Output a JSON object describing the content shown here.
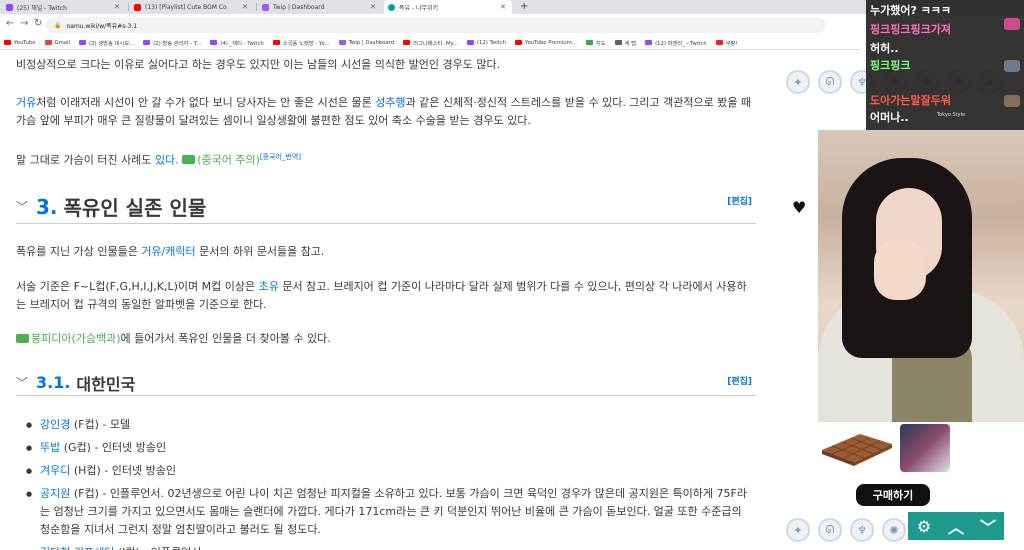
{
  "tabs": [
    {
      "title": "(25) 채널 - Twitch",
      "color": "#9146ff"
    },
    {
      "title": "(13) [Playlist] Cute BGM Co",
      "color": "#ff0000"
    },
    {
      "title": "Twip | Dashboard",
      "color": "#9b5de5"
    },
    {
      "title": "폭유 - 나무위키",
      "color": "#00a495"
    }
  ],
  "address": {
    "url": "namu.wiki/w/폭유#s-3.1"
  },
  "bookmarks": [
    {
      "label": "YouTube",
      "color": "#ff0000"
    },
    {
      "label": "Gmail",
      "color": "#ea4335"
    },
    {
      "label": "(2) 생방송 대시보...",
      "color": "#9146ff"
    },
    {
      "label": "(2) 방송 관리자 - T...",
      "color": "#9146ff"
    },
    {
      "label": "(4) _채티 - Twitch",
      "color": "#9146ff"
    },
    {
      "label": "소국동 노래방 - Yo...",
      "color": "#ff0000"
    },
    {
      "label": "Twip | Dashboard",
      "color": "#9b5de5"
    },
    {
      "label": "러그나페스타 -My...",
      "color": "#ff0000"
    },
    {
      "label": "(12) Twitch",
      "color": "#9146ff"
    },
    {
      "label": "YouTube Premium...",
      "color": "#ff0000"
    },
    {
      "label": "지도",
      "color": "#34a853"
    },
    {
      "label": "새 탭",
      "color": "#5f6368"
    },
    {
      "label": "(12) 마젠타_ - Twitch",
      "color": "#9146ff"
    },
    {
      "label": "쿠팡!",
      "color": "#e52528"
    }
  ],
  "article": {
    "p_top": "비정상적으로 크다는 이유로 싫어다고 하는 경우도 있지만 이는 남들의 시선을 의식한 발언인 경우도 많다.",
    "p2_link1": "거유",
    "p2_text1": "처럼 이래저래 시선이 안 갈 수가 없다 보니 당사자는 안 좋은 시선은 물론 ",
    "p2_link2": "성추행",
    "p2_text2": "과 같은 신체적·정신적 스트레스를 받을 수 있다. 그리고 객관적으로 봤을 때 가슴 앞에 부피가 매우 큰 질량물이 달려있는 셈이니 일상생활에 불편한 점도 있어 축소 수술을 받는 경우도 있다.",
    "p3_text": "말 그대로 가슴이 터진 사례도 ",
    "p3_link": "있다.",
    "p3_ext": "(중국어 주의)",
    "p3_sup": "[중국어_번역]",
    "h2": {
      "num": "3.",
      "title": "폭유인 실존 인물",
      "edit": "[편집]"
    },
    "p4_text1": "폭유를 지닌 가상 인물들은 ",
    "p4_link": "거유/캐릭터",
    "p4_text2": " 문서의 하위 문서들을 참고.",
    "p5_text1": "서술 기준은 F~L컵(F,G,H,I,J,K,L)이며 M컵 이상은 ",
    "p5_link": "초유",
    "p5_text2": " 문서 참고. 브레지어 컵 기준이 나라마다 달라 실제 범위가 다를 수 있으나, 편의상 각 나라에서 사용하는 브레지어 컵 규격의 동일한 알파벳을 기준으로 한다.",
    "p6_ext": "붕피디아(가슴백과)",
    "p6_text": "에 들어가서 폭유인 인물을 더 찾아볼 수 있다.",
    "h3": {
      "num": "3.1.",
      "title": "대한민국",
      "edit": "[편집]"
    },
    "list": [
      {
        "link": "강인경",
        "text": " (F컵) - 모델"
      },
      {
        "link": "뚜밥",
        "text": " (G컵) - 인터넷 방송인"
      },
      {
        "link": "겨우디",
        "text": " (H컵) - 인터넷 방송인"
      },
      {
        "link": "공지원",
        "text": " (F컵) - 인플루언서. 02년생으로 어린 나이 치곤 엄청난 피지컬을 소유하고 있다. 보통 가슴이 크면 육덕인 경우가 많은데 공지원은 특이하게 75F라는 엄청난 크기를 가지고 있으면서도 몸매는 슬랜더에 가깝다. 게다가 171cm라는 큰 키 덕분인지 뛰어난 비율에 큰 가슴이 돋보인다. 얼굴 또한 수준급의 청순함을 지녀서 그런지 정말 엄친딸이라고 불러도 될 정도다."
      },
      {
        "link": "김다현 리프세터",
        "text": " (I컵) - 인플루언서"
      }
    ]
  },
  "stream": {
    "chat": [
      {
        "text": "누가했어? ㅋㅋㅋ",
        "color": "#ffffff"
      },
      {
        "text": "핑크핑크핑크가져",
        "color": "#ff6fb5"
      },
      {
        "text": "허허..",
        "color": "#ffffff"
      },
      {
        "text": "핑크핑크",
        "color": "#7dff7d"
      },
      {
        "text": "도아가는말잘두워",
        "color": "#ff5a4a"
      },
      {
        "text": "어머나..",
        "color": "#ffffff"
      }
    ],
    "overlay_label": "Tokyo Style",
    "buy_label": "구매하기",
    "controls": {
      "settings": "⚙",
      "up": "︿",
      "down": "﹀"
    }
  }
}
